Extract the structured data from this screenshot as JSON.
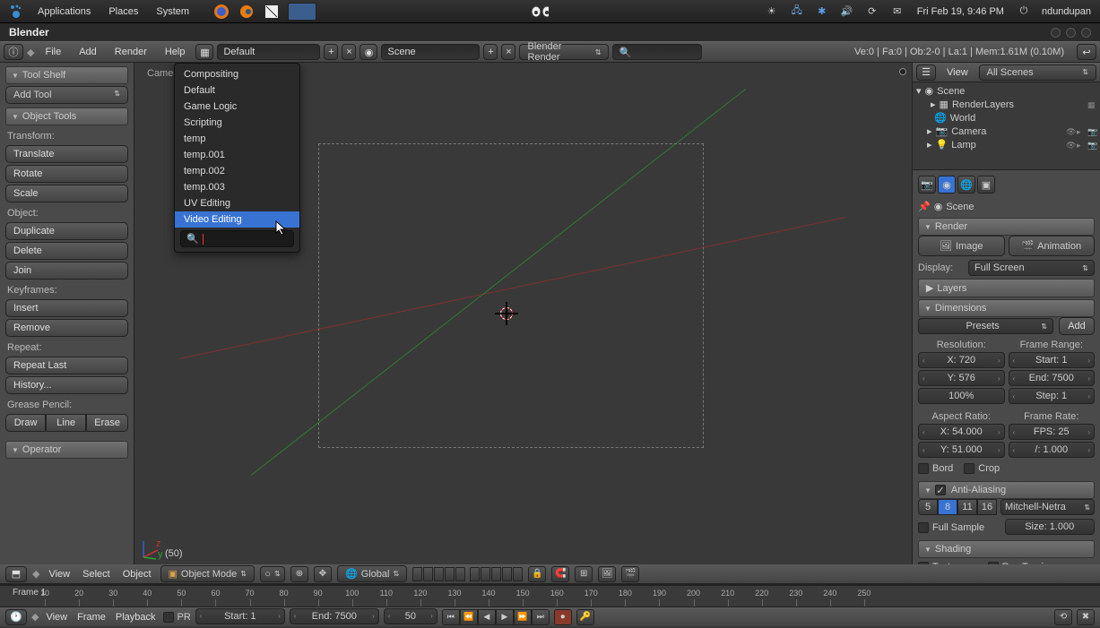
{
  "taskbar": {
    "apps": "Applications",
    "places": "Places",
    "system": "System",
    "time": "Fri Feb 19,  9:46 PM",
    "user": "ndundupan"
  },
  "titlebar": {
    "title": "Blender"
  },
  "infoheader": {
    "file": "File",
    "add": "Add",
    "render": "Render",
    "help": "Help",
    "layout": "Default",
    "scene": "Scene",
    "engine": "Blender Render",
    "stats": "Ve:0 | Fa:0 | Ob:2-0 | La:1 | Mem:1.61M (0.10M)"
  },
  "dropdown": {
    "items": [
      "Compositing",
      "Default",
      "Game Logic",
      "Scripting",
      "temp",
      "temp.001",
      "temp.002",
      "temp.003",
      "UV Editing",
      "Video Editing"
    ],
    "selected": "Video Editing"
  },
  "toolshelf": {
    "header1": "Tool Shelf",
    "addtool": "Add Tool",
    "header2": "Object Tools",
    "transform": "Transform:",
    "translate": "Translate",
    "rotate": "Rotate",
    "scale": "Scale",
    "object": "Object:",
    "duplicate": "Duplicate",
    "delete": "Delete",
    "join": "Join",
    "keyframes": "Keyframes:",
    "insert": "Insert",
    "remove": "Remove",
    "repeat": "Repeat:",
    "repeatlast": "Repeat Last",
    "history": "History...",
    "gpencil": "Grease Pencil:",
    "draw": "Draw",
    "line": "Line",
    "erase": "Erase",
    "operator": "Operator"
  },
  "viewport": {
    "label": "Camera",
    "frame": "(50)"
  },
  "outliner": {
    "view": "View",
    "allscenes": "All Scenes",
    "scene": "Scene",
    "renderlayers": "RenderLayers",
    "world": "World",
    "camera": "Camera",
    "lamp": "Lamp"
  },
  "props": {
    "scene": "Scene",
    "render": "Render",
    "image": "Image",
    "animation": "Animation",
    "display": "Display:",
    "fullscreen": "Full Screen",
    "layers": "Layers",
    "dimensions": "Dimensions",
    "presets": "Presets",
    "add": "Add",
    "resolution": "Resolution:",
    "framerange": "Frame Range:",
    "x": "X: 720",
    "y": "Y: 576",
    "pct": "100%",
    "start": "Start: 1",
    "end": "End: 7500",
    "step": "Step: 1",
    "aspect": "Aspect Ratio:",
    "framerate": "Frame Rate:",
    "ax": "X: 54.000",
    "ay": "Y: 51.000",
    "fps": "FPS: 25",
    "fpsb": "/: 1.000",
    "bord": "Bord",
    "crop": "Crop",
    "aa": "Anti-Aliasing",
    "s5": "5",
    "s8": "8",
    "s11": "11",
    "s16": "16",
    "mitchell": "Mitchell-Netra",
    "fullsample": "Full Sample",
    "size": "Size: 1.000",
    "shading": "Shading",
    "textures": "Textures",
    "raytracing": "Ray Tracing"
  },
  "v3dheader": {
    "view": "View",
    "select": "Select",
    "object": "Object",
    "mode": "Object Mode",
    "global": "Global"
  },
  "timeline": {
    "flabel": "Frame 1",
    "ticks": [
      10,
      20,
      30,
      40,
      50,
      60,
      70,
      80,
      90,
      100,
      110,
      120,
      130,
      140,
      150,
      160,
      170,
      180,
      190,
      200,
      210,
      220,
      230,
      240,
      250
    ]
  },
  "tlheader": {
    "view": "View",
    "frame": "Frame",
    "playback": "Playback",
    "pr": "PR",
    "start": "Start: 1",
    "end": "End: 7500",
    "cur": "50"
  }
}
